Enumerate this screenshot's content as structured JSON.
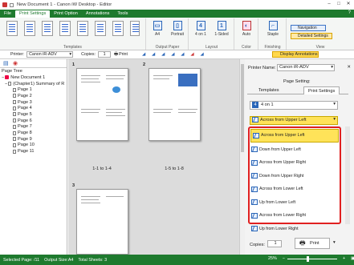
{
  "window": {
    "title": "New Document 1 - Canon iW Desktop - Editor",
    "minimize": "–",
    "maximize": "□",
    "close": "✕"
  },
  "tabs": [
    "File",
    "Print Settings",
    "Print Option",
    "Annotations",
    "Tools"
  ],
  "ribbon": {
    "groups": {
      "templates": "Templates",
      "output_paper": "Output Paper",
      "layout": "Layout",
      "color": "Color",
      "finishing": "Finishing",
      "view": "View"
    },
    "buttons": {
      "a4": "A4",
      "portrait": "Portrait",
      "n_on_1": "4 on 1",
      "sided": "1-Sided",
      "auto": "Auto",
      "staple": "Staple"
    },
    "navigation": "Navigation",
    "detailed_settings": "Detailed Settings"
  },
  "toolbar": {
    "printer_label": "Printer:",
    "printer_value": "Canon iR-ADV",
    "copies_label": "Copies:",
    "copies_value": "1",
    "print_label": "Print",
    "display_annotations": "Display Annotations"
  },
  "left": {
    "tree_title": "Page Tree",
    "root": "New Document 1",
    "chapter": "(Chapter1) Summary of R",
    "pages": [
      "Page 1",
      "Page 2",
      "Page 3",
      "Page 4",
      "Page 5",
      "Page 6",
      "Page 7",
      "Page 8",
      "Page 9",
      "Page 10",
      "Page 11"
    ]
  },
  "center": {
    "sheets": [
      {
        "num": "1",
        "label": "1-1 to 1-4"
      },
      {
        "num": "2",
        "label": "1-5 to 1-8"
      },
      {
        "num": "3",
        "label": ""
      }
    ]
  },
  "right": {
    "printer_name_label": "Printer Name:",
    "printer_name_value": "Canon iR-ADV",
    "page_setting_label": "Page Setting:",
    "tab_templates": "Templates",
    "tab_print_settings": "Print Settings",
    "layout_value": "4 on 1",
    "order_value": "Across from Upper Left",
    "order_options": [
      "Across from Upper Left",
      "Down from Upper Left",
      "Across from Upper Right",
      "Down from Upper Right",
      "Across from Lower Left",
      "Up from Lower Left",
      "Across from Lower Right",
      "Up from Lower Right"
    ],
    "copies_label": "Copies:",
    "copies_value": "1",
    "print_button": "Print"
  },
  "status": {
    "selected": "Selected Page: /11",
    "output_size": "Output Size:A4",
    "total_sheets": "Total Sheets: 3",
    "zoom": "25%"
  }
}
